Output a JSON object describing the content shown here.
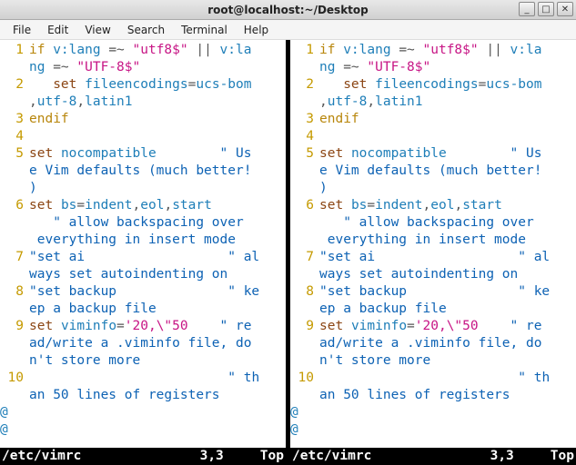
{
  "titlebar": {
    "title": "root@localhost:~/Desktop"
  },
  "win_buttons": {
    "min": "_",
    "max": "□",
    "close": "✕"
  },
  "menu": [
    "File",
    "Edit",
    "View",
    "Search",
    "Terminal",
    "Help"
  ],
  "status": {
    "filename": "/etc/vimrc",
    "cursor": "3,3",
    "scroll": "Top"
  },
  "code_lines": [
    {
      "n": "1",
      "seg": [
        [
          "kw",
          "if"
        ],
        [
          "op",
          " "
        ],
        [
          "id",
          "v:lang"
        ],
        [
          "op",
          " =~ "
        ],
        [
          "str",
          "\"utf8$\""
        ],
        [
          "op",
          " || "
        ],
        [
          "id",
          "v:la"
        ]
      ]
    },
    {
      "n": "",
      "seg": [
        [
          "id",
          "ng"
        ],
        [
          "op",
          " =~ "
        ],
        [
          "str",
          "\"UTF-8$\""
        ]
      ]
    },
    {
      "n": "2",
      "seg": [
        [
          "op",
          "   "
        ],
        [
          "cmd",
          "set"
        ],
        [
          "op",
          " "
        ],
        [
          "opt",
          "fileencodings"
        ],
        [
          "op",
          "="
        ],
        [
          "id",
          "ucs-bom"
        ]
      ]
    },
    {
      "n": "",
      "seg": [
        [
          "op",
          ","
        ],
        [
          "id",
          "utf-8"
        ],
        [
          "op",
          ","
        ],
        [
          "id",
          "latin1"
        ]
      ]
    },
    {
      "n": "3",
      "seg": [
        [
          "kw",
          "endif"
        ]
      ]
    },
    {
      "n": "4",
      "seg": []
    },
    {
      "n": "5",
      "seg": [
        [
          "cmd",
          "set"
        ],
        [
          "op",
          " "
        ],
        [
          "opt",
          "nocompatible"
        ],
        [
          "op",
          "        "
        ],
        [
          "cmt",
          "\" Us"
        ]
      ]
    },
    {
      "n": "",
      "seg": [
        [
          "cmt",
          "e Vim defaults (much better!"
        ]
      ]
    },
    {
      "n": "",
      "seg": [
        [
          "cmt",
          ")"
        ]
      ]
    },
    {
      "n": "6",
      "seg": [
        [
          "cmd",
          "set"
        ],
        [
          "op",
          " "
        ],
        [
          "opt",
          "bs"
        ],
        [
          "op",
          "="
        ],
        [
          "id",
          "indent"
        ],
        [
          "op",
          ","
        ],
        [
          "id",
          "eol"
        ],
        [
          "op",
          ","
        ],
        [
          "id",
          "start"
        ]
      ]
    },
    {
      "n": "",
      "seg": [
        [
          "op",
          "   "
        ],
        [
          "cmt",
          "\" allow backspacing over"
        ]
      ]
    },
    {
      "n": "",
      "seg": [
        [
          "cmt",
          " everything in insert mode"
        ]
      ]
    },
    {
      "n": "7",
      "seg": [
        [
          "cmt",
          "\"set ai                  \" al"
        ]
      ]
    },
    {
      "n": "",
      "seg": [
        [
          "cmt",
          "ways set autoindenting on"
        ]
      ]
    },
    {
      "n": "8",
      "seg": [
        [
          "cmt",
          "\"set backup              \" ke"
        ]
      ]
    },
    {
      "n": "",
      "seg": [
        [
          "cmt",
          "ep a backup file"
        ]
      ]
    },
    {
      "n": "9",
      "seg": [
        [
          "cmd",
          "set"
        ],
        [
          "op",
          " "
        ],
        [
          "opt",
          "viminfo"
        ],
        [
          "op",
          "="
        ],
        [
          "str",
          "'20,\\\"50"
        ],
        [
          "op",
          "    "
        ],
        [
          "cmt",
          "\" re"
        ]
      ]
    },
    {
      "n": "",
      "seg": [
        [
          "cmt",
          "ad/write a .viminfo file, do"
        ]
      ]
    },
    {
      "n": "",
      "seg": [
        [
          "cmt",
          "n't store more"
        ]
      ]
    },
    {
      "n": "10",
      "seg": [
        [
          "op",
          "                         "
        ],
        [
          "cmt",
          "\" th"
        ]
      ]
    },
    {
      "n": "",
      "seg": [
        [
          "cmt",
          "an 50 lines of registers"
        ]
      ]
    }
  ],
  "tilde": "@"
}
